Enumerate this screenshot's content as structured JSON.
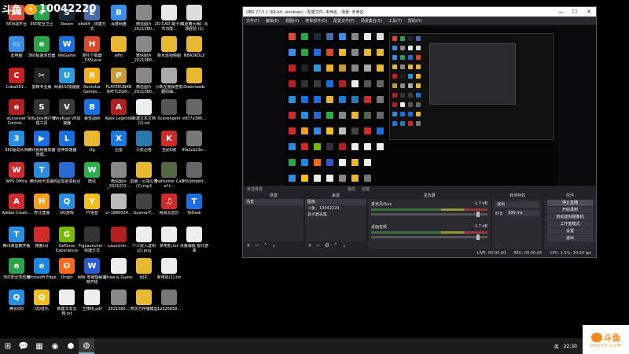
{
  "watermark": {
    "text": "斗鱼",
    "id": "10042220"
  },
  "desktop_icons": [
    {
      "label": "5E对战平台",
      "color": "#e04a3a",
      "glyph": "5E",
      "col": 0,
      "row": 0
    },
    {
      "label": "360安全卫士",
      "color": "#2aa34a",
      "glyph": "+",
      "col": 1,
      "row": 0
    },
    {
      "label": "Steam",
      "color": "#1b2838",
      "glyph": "S",
      "col": 2,
      "row": 0
    },
    {
      "label": "ebs64 - 快捷方式",
      "color": "#4a6aa8",
      "glyph": "E",
      "col": 3,
      "row": 0
    },
    {
      "label": "百度网盘",
      "color": "#3a8ee6",
      "glyph": "B",
      "col": 4,
      "row": 0
    },
    {
      "label": "微信图片_2021080...",
      "color": "#888888",
      "glyph": "",
      "col": 5,
      "row": 0
    },
    {
      "label": "2D-CAD-跟卡城市功能...",
      "color": "#e8e8e8",
      "glyph": "",
      "col": 6,
      "row": 0
    },
    {
      "label": "【更精大赛】青球经验 (1)",
      "color": "#dddddd",
      "glyph": "",
      "col": 7,
      "row": 0
    },
    {
      "label": "此电脑",
      "color": "#3a8ee6",
      "glyph": "▭",
      "col": 0,
      "row": 1
    },
    {
      "label": "360极速浏览器",
      "color": "#2aa34a",
      "glyph": "e",
      "col": 1,
      "row": 1
    },
    {
      "label": "WeGame",
      "color": "#1a6fe0",
      "glyph": "W",
      "col": 2,
      "row": 1
    },
    {
      "label": "虎扑下载器_535Leve",
      "color": "#d94a2a",
      "glyph": "H",
      "col": 3,
      "row": 1
    },
    {
      "label": "wfin",
      "color": "#e8b830",
      "glyph": "",
      "col": 4,
      "row": 1
    },
    {
      "label": "微信图片_2021080...",
      "color": "#888888",
      "glyph": "",
      "col": 5,
      "row": 1
    },
    {
      "label": "新水远视频图",
      "color": "#e8b830",
      "glyph": "",
      "col": 6,
      "row": 1
    },
    {
      "label": "NBA2KOL2",
      "color": "#e8b830",
      "glyph": "",
      "col": 7,
      "row": 1
    },
    {
      "label": "Cobalt01...",
      "color": "#c82020",
      "glyph": "C",
      "col": 0,
      "row": 2
    },
    {
      "label": "剪映专业版",
      "color": "#222222",
      "glyph": "✂",
      "col": 1,
      "row": 2
    },
    {
      "label": "网易UU加速器",
      "color": "#2a9ae0",
      "glyph": "U",
      "col": 2,
      "row": 2
    },
    {
      "label": "Rockstar Games...",
      "color": "#f2b01e",
      "glyph": "R",
      "col": 3,
      "row": 2
    },
    {
      "label": "PLAYERUNKN BATTLEGR...",
      "color": "#c89a3a",
      "glyph": "P",
      "col": 4,
      "row": 2
    },
    {
      "label": "微信图片_2021080...",
      "color": "#888888",
      "glyph": "",
      "col": 5,
      "row": 2
    },
    {
      "label": "小新在朋探查有趣的曲...",
      "color": "#aaaaaa",
      "glyph": "",
      "col": 6,
      "row": 2
    },
    {
      "label": "Downloads",
      "color": "#e8b830",
      "glyph": "",
      "col": 7,
      "row": 2
    },
    {
      "label": "eLicenser Control...",
      "color": "#b02020",
      "glyph": "e",
      "col": 0,
      "row": 3
    },
    {
      "label": "StKuboy用户管理工具",
      "color": "#333333",
      "glyph": "S",
      "col": 1,
      "row": 3
    },
    {
      "label": "VeryKuai VK加速器",
      "color": "#3a3a3a",
      "glyph": "V",
      "col": 2,
      "row": 3
    },
    {
      "label": "暴雪战网",
      "color": "#1a6fe0",
      "glyph": "B",
      "col": 3,
      "row": 3
    },
    {
      "label": "Apex Legends",
      "color": "#b02020",
      "glyph": "A",
      "col": 4,
      "row": 3
    },
    {
      "label": "新建文本文档 (2).txt",
      "color": "#eeeeee",
      "glyph": "",
      "col": 5,
      "row": 3
    },
    {
      "label": "Scavengers",
      "color": "#555555",
      "glyph": "",
      "col": 6,
      "row": 3
    },
    {
      "label": "e837a386...",
      "color": "#666666",
      "glyph": "",
      "col": 7,
      "row": 3
    },
    {
      "label": "360驱动大师",
      "color": "#2a8ee0",
      "glyph": "3",
      "col": 0,
      "row": 4
    },
    {
      "label": "腾讯视频播放器管理...",
      "color": "#1a6fe0",
      "glyph": "▶",
      "col": 1,
      "row": 4
    },
    {
      "label": "雷神加速器",
      "color": "#1a6fe0",
      "glyph": "L",
      "col": 2,
      "row": 4
    },
    {
      "label": "cfg",
      "color": "#e8b830",
      "glyph": "",
      "col": 3,
      "row": 4
    },
    {
      "label": "迅雷",
      "color": "#1a7ae0",
      "glyph": "X",
      "col": 4,
      "row": 4
    },
    {
      "label": "火影忍者",
      "color": "#2a7ab0",
      "glyph": "",
      "col": 5,
      "row": 4
    },
    {
      "label": "全民K歌",
      "color": "#d02a2a",
      "glyph": "K",
      "col": 6,
      "row": 4
    },
    {
      "label": "9fa2cb13e...",
      "color": "#777777",
      "glyph": "",
      "col": 7,
      "row": 4
    },
    {
      "label": "WPS Office",
      "color": "#d02a2a",
      "glyph": "W",
      "col": 0,
      "row": 5
    },
    {
      "label": "腾讯网卡加速",
      "color": "#2a8ee0",
      "glyph": "T",
      "col": 1,
      "row": 5
    },
    {
      "label": "鸿星加更高经合",
      "color": "#2a6ad0",
      "glyph": "",
      "col": 2,
      "row": 5
    },
    {
      "label": "微信",
      "color": "#2aae4a",
      "glyph": "W",
      "col": 3,
      "row": 5
    },
    {
      "label": "微信图片_2021072...",
      "color": "#888888",
      "glyph": "",
      "col": 4,
      "row": 5
    },
    {
      "label": "屏幕 - 引领公司(2).mp3",
      "color": "#e8b830",
      "glyph": "",
      "col": 5,
      "row": 5
    },
    {
      "label": "theHunter Call of t...",
      "color": "#556644",
      "glyph": "",
      "col": 6,
      "row": 5
    },
    {
      "label": "3f0cbfdafd...",
      "color": "#666666",
      "glyph": "",
      "col": 7,
      "row": 5
    },
    {
      "label": "Adobe Creati...",
      "color": "#d02a2a",
      "glyph": "A",
      "col": 0,
      "row": 6
    },
    {
      "label": "虎牙直播",
      "color": "#f2a01e",
      "glyph": "H",
      "col": 1,
      "row": 6
    },
    {
      "label": "QQ游戏",
      "color": "#2a8ee0",
      "glyph": "Q",
      "col": 2,
      "row": 6
    },
    {
      "label": "YY语音",
      "color": "#f2c01e",
      "glyph": "Y",
      "col": 3,
      "row": 6
    },
    {
      "label": "cr-1680034...",
      "color": "#bbbbbb",
      "glyph": "",
      "col": 4,
      "row": 6
    },
    {
      "label": "GuomorT...",
      "color": "#444444",
      "glyph": "",
      "col": 5,
      "row": 6
    },
    {
      "label": "网易云音乐",
      "color": "#d02a2a",
      "glyph": "♫",
      "col": 6,
      "row": 6
    },
    {
      "label": "ToDesk",
      "color": "#1a6fe0",
      "glyph": "T",
      "col": 7,
      "row": 6
    },
    {
      "label": "腾讯课堂教学版",
      "color": "#2a8ee0",
      "glyph": "T",
      "col": 0,
      "row": 7
    },
    {
      "label": "搜索(a)",
      "color": "#d02a2a",
      "glyph": "",
      "col": 1,
      "row": 7
    },
    {
      "label": "GeForce Experience",
      "color": "#76b900",
      "glyph": "G",
      "col": 2,
      "row": 7
    },
    {
      "label": "FrgLauncher - 快捷方式",
      "color": "#333333",
      "glyph": "",
      "col": 3,
      "row": 7
    },
    {
      "label": "Launcher...",
      "color": "#b02020",
      "glyph": "",
      "col": 4,
      "row": 7
    },
    {
      "label": "个人收入证明(2).png",
      "color": "#eeeeee",
      "glyph": "",
      "col": 5,
      "row": 7
    },
    {
      "label": "新电机.txt",
      "color": "#eeeeee",
      "glyph": "",
      "col": 6,
      "row": 7
    },
    {
      "label": "决赛海报 报代意事",
      "color": "#eeeeee",
      "glyph": "",
      "col": 7,
      "row": 7
    },
    {
      "label": "360安全浏览器",
      "color": "#2aa34a",
      "glyph": "e",
      "col": 0,
      "row": 8
    },
    {
      "label": "Microsoft Edge",
      "color": "#1a8ae0",
      "glyph": "e",
      "col": 1,
      "row": 8
    },
    {
      "label": "Origin",
      "color": "#f26a1e",
      "glyph": "O",
      "col": 2,
      "row": 8
    },
    {
      "label": "网科 地接理解播用开班",
      "color": "#2a5ad0",
      "glyph": "W",
      "col": 3,
      "row": 8
    },
    {
      "label": "Draw & Guess",
      "color": "#eeeeee",
      "glyph": "",
      "col": 4,
      "row": 8
    },
    {
      "label": "团子",
      "color": "#e8b830",
      "glyph": "",
      "col": 5,
      "row": 8
    },
    {
      "label": "新电机(1).txt",
      "color": "#eeeeee",
      "glyph": "",
      "col": 6,
      "row": 8
    },
    {
      "label": "腾讯QQ",
      "color": "#2a8ee0",
      "glyph": "Q",
      "col": 0,
      "row": 9
    },
    {
      "label": "QQ音乐",
      "color": "#f2c01e",
      "glyph": "Q",
      "col": 1,
      "row": 9
    },
    {
      "label": "新建文本文档.txt",
      "color": "#eeeeee",
      "glyph": "",
      "col": 2,
      "row": 9
    },
    {
      "label": "王楼核.pdf",
      "color": "#eeeeee",
      "glyph": "",
      "col": 3,
      "row": 9
    },
    {
      "label": "2021080...",
      "color": "#888888",
      "glyph": "",
      "col": 4,
      "row": 9
    },
    {
      "label": "奇次方存储模型",
      "color": "#e8b830",
      "glyph": "",
      "col": 5,
      "row": 9
    },
    {
      "label": "1b326658...",
      "color": "#777777",
      "glyph": "",
      "col": 6,
      "row": 9
    }
  ],
  "obs": {
    "title": "OBS 27.0.1 (64-bit, windows) - 配置文件: 未命名 - 场景: 未命名",
    "menu": [
      "文件(F)",
      "编辑(E)",
      "视图(V)",
      "停靠部件(D)",
      "配置文件(P)",
      "场景集合(S)",
      "工具(T)",
      "帮助(H)"
    ],
    "window_buttons": [
      "—",
      "☐",
      "✕"
    ],
    "docks": {
      "scenes": {
        "header": "场景",
        "items": [
          "场景"
        ]
      },
      "sources": {
        "header": "来源",
        "items": [
          "图像",
          "斗鱼：10042220",
          "显示器采集"
        ]
      },
      "mixer": {
        "header": "混音器",
        "tracks": [
          {
            "name": "麦克风/Aux",
            "db": "-1.7 dB"
          },
          {
            "name": "桌面音频",
            "db": "-1.7 dB"
          }
        ]
      },
      "transitions": {
        "header": "转场特效",
        "type_label": "淡出",
        "duration_label": "时长",
        "duration_value": "300 ms"
      },
      "controls": {
        "header": "控件",
        "buttons": [
          "停止直播",
          "开始录制",
          "启动虚拟摄像机",
          "工作室模式",
          "设置",
          "退出"
        ]
      }
    },
    "status": {
      "live": "LIVE: 00:00:00",
      "rec": "REC: 00:00:00",
      "cpu": "CPU: 1.5%, 30.00 fps"
    },
    "missing_sources_label": "未选择源",
    "properties_label": "属性",
    "filters_label": "滤镜"
  },
  "taskbar": {
    "apps": [
      "⊞",
      "💬",
      "▦",
      "◉",
      "⬢",
      "◍"
    ],
    "tray": {
      "ime": "英",
      "time": "22:30"
    }
  },
  "douyu_logo": {
    "name": "斗鱼",
    "sub": "DOUYU.COM"
  }
}
